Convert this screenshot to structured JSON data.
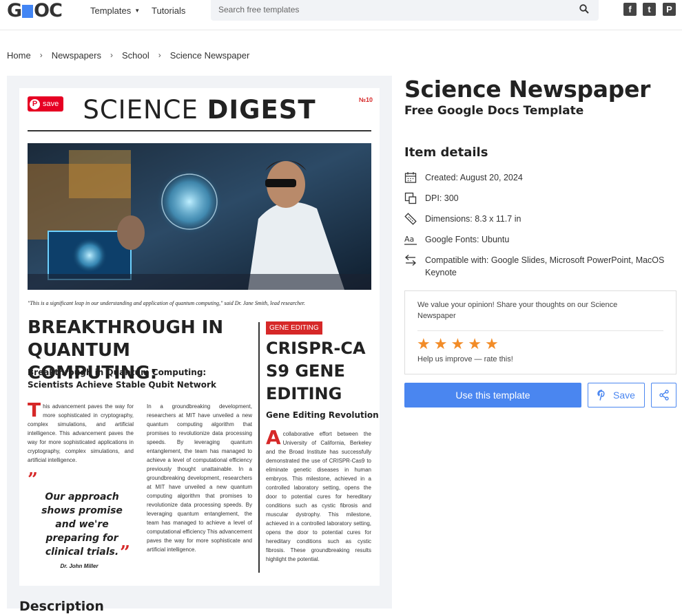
{
  "header": {
    "logo": {
      "left": "G",
      "right": "OC"
    },
    "nav": [
      {
        "label": "Templates"
      },
      {
        "label": "Tutorials"
      }
    ],
    "search": {
      "placeholder": "Search free templates"
    },
    "social": [
      {
        "icon": "facebook-icon",
        "glyph": "f"
      },
      {
        "icon": "twitter-icon",
        "glyph": "t"
      },
      {
        "icon": "pinterest-icon",
        "glyph": "P"
      }
    ]
  },
  "breadcrumb": [
    "Home",
    "Newspapers",
    "School",
    "Science Newspaper"
  ],
  "preview": {
    "pin_save": "save",
    "masthead_light": "SCIENCE ",
    "masthead_bold": "DIGEST",
    "issue": "№10",
    "quote": "\"This is a significant leap in our understanding and application of quantum computing,\" said Dr. Jane Smith, lead researcher.",
    "headline": "BREAKTHROUGH IN QUANTUM COMPUTING:",
    "subheadline": "Breakthrough in Quantum Computing: Scientists Achieve Stable Qubit Network",
    "col1_drop": "T",
    "col1": "his advancement paves the way for more sophisticated in cryptography, complex simulations, and artificial intelligence. This advancement paves the way for more sophisticated applications in cryptography, complex simulations, and artificial intelligence.",
    "col2": "In a groundbreaking development, researchers at MIT have unveiled a new quantum computing algorithm that promises to revolutionize data processing speeds. By leveraging quantum entanglement, the team has managed to achieve a level of computational efficiency previously thought unattainable. In a groundbreaking development, researchers at MIT have unveiled a new quantum computing algorithm that promises to revolutionize data processing speeds. By leveraging quantum entanglement, the team has managed to achieve a level of computational efficiency This advancement paves the way for more sophisticate and artificial intelligence.",
    "pull_quote": "Our approach shows promise and we're preparing for clinical trials.",
    "pull_author": "Dr. John Miller",
    "tag": "GENE EDITING",
    "headline2": "CRISPR-CA S9 GENE EDITING",
    "subheadline2": "Gene Editing Revolution",
    "col3_drop": "A",
    "col3": "collaborative effort between the University of California, Berkeley and the Broad Institute has successfully demonstrated the use of CRISPR-Cas9 to eliminate genetic diseases in human embryos. This milestone, achieved in a controlled laboratory setting, opens the door to potential cures for hereditary conditions such as cystic fibrosis and muscular dystrophy. This milestone, achieved in a controlled laboratory setting, opens the door to potential cures for hereditary conditions such as cystic fibrosis. These groundbreaking results highlight the potential."
  },
  "description_heading": "Description",
  "product": {
    "title": "Science Newspaper",
    "subtitle": "Free Google Docs Template",
    "details_heading": "Item details",
    "details": [
      {
        "icon": "calendar-icon",
        "text": "Created: August 20, 2024"
      },
      {
        "icon": "dpi-icon",
        "text": "DPI: 300"
      },
      {
        "icon": "ruler-icon",
        "text": "Dimensions: 8.3 x 11.7 in"
      },
      {
        "icon": "font-icon",
        "text": "Google Fonts: Ubuntu"
      },
      {
        "icon": "compatibility-icon",
        "text": "Compatible with: Google Slides, Microsoft PowerPoint, MacOS Keynote"
      }
    ]
  },
  "feedback": {
    "message": "We value your opinion! Share your thoughts on our Science Newspaper",
    "rating": 5,
    "help": "Help us improve — rate this!"
  },
  "actions": {
    "use": "Use this template",
    "save": "Save"
  },
  "colors": {
    "accent": "#4a86f0",
    "red": "#d62828",
    "star": "#f28c28"
  }
}
